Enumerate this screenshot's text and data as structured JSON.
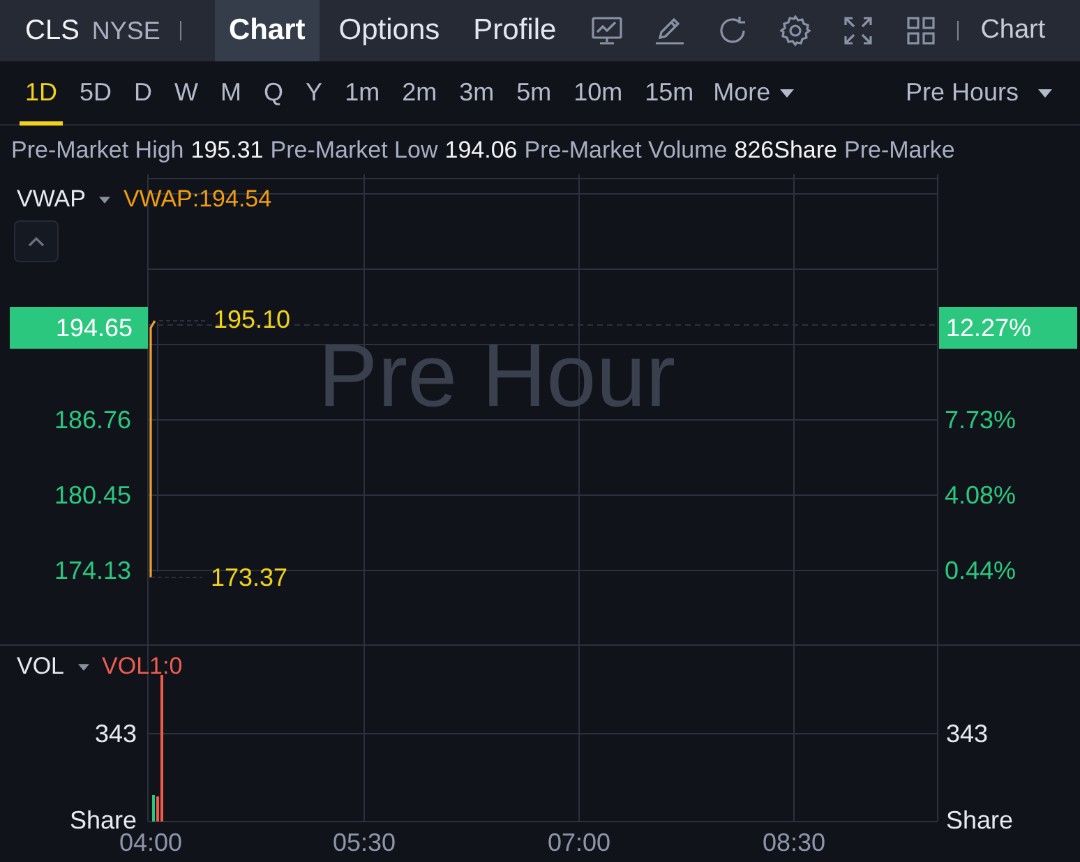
{
  "header": {
    "symbol": "CLS",
    "exchange": "NYSE",
    "tabs": [
      {
        "label": "Chart",
        "selected": true
      },
      {
        "label": "Options",
        "selected": false
      },
      {
        "label": "Profile",
        "selected": false
      }
    ],
    "tools": [
      {
        "kind": "chart"
      },
      {
        "kind": "draw"
      },
      {
        "kind": "refresh"
      },
      {
        "kind": "settings"
      },
      {
        "kind": "fullscreen"
      },
      {
        "kind": "layout"
      }
    ],
    "trailing_label": "Chart"
  },
  "periods": [
    {
      "label": "1D",
      "selected": true
    },
    {
      "label": "5D",
      "selected": false
    },
    {
      "label": "D",
      "selected": false
    },
    {
      "label": "W",
      "selected": false
    },
    {
      "label": "M",
      "selected": false
    },
    {
      "label": "Q",
      "selected": false
    },
    {
      "label": "Y",
      "selected": false
    },
    {
      "label": "1m",
      "selected": false
    },
    {
      "label": "2m",
      "selected": false
    },
    {
      "label": "3m",
      "selected": false
    },
    {
      "label": "5m",
      "selected": false
    },
    {
      "label": "10m",
      "selected": false
    },
    {
      "label": "15m",
      "selected": false
    }
  ],
  "more": {
    "label": "More"
  },
  "session": {
    "label": "Pre Hours"
  },
  "stats": [
    {
      "label": "Pre-Market High",
      "value": "195.31"
    },
    {
      "label": "Pre-Market Low",
      "value": "194.06"
    },
    {
      "label": "Pre-Market Volume",
      "value": "826Share"
    },
    {
      "label": "Pre-Marke"
    }
  ],
  "price_panel": {
    "indicator": "VWAP",
    "indicator_value": "VWAP:194.54",
    "watermark": "Pre Hour",
    "current_price": "194.65",
    "current_change": "12.27%",
    "price_ticks": [
      "186.76",
      "180.45",
      "174.13"
    ],
    "percent_ticks": [
      "7.73%",
      "4.08%",
      "0.44%"
    ],
    "high_label": "195.10",
    "low_label": "173.37"
  },
  "volume_panel": {
    "indicator": "VOL",
    "indicator_value": "VOL1:0",
    "left_tick": "343",
    "left_unit": "Share",
    "right_tick": "343",
    "right_unit": "Share",
    "time_ticks": [
      "04:00",
      "05:30",
      "07:00",
      "08:30"
    ]
  }
}
